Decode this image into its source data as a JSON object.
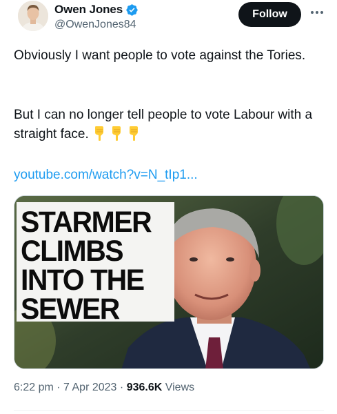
{
  "author": {
    "display_name": "Owen Jones",
    "handle": "@OwenJones84",
    "verified": true
  },
  "follow_label": "Follow",
  "tweet": {
    "paragraph_1": "Obviously I want people to vote against the Tories.",
    "paragraph_2": "But I can no longer tell people to vote Labour with a straight face.",
    "emojis": [
      "backhand-index-pointing-down",
      "backhand-index-pointing-down",
      "backhand-index-pointing-down"
    ],
    "link": "youtube.com/watch?v=N_tIp1..."
  },
  "media": {
    "headline_lines": [
      "STARMER",
      "CLIMBS",
      "INTO THE",
      "SEWER"
    ]
  },
  "meta": {
    "time": "6:22 pm",
    "date": "7 Apr 2023",
    "sep": "·",
    "views_count": "936.6K",
    "views_label": "Views"
  },
  "colors": {
    "link": "#1d9bf0",
    "verified": "#1d9bf0",
    "follow_bg": "#0f1419",
    "secondary_text": "#536471"
  },
  "icons": [
    "verified-badge-icon",
    "more-options-icon",
    "pointing-down-emoji-icon"
  ]
}
